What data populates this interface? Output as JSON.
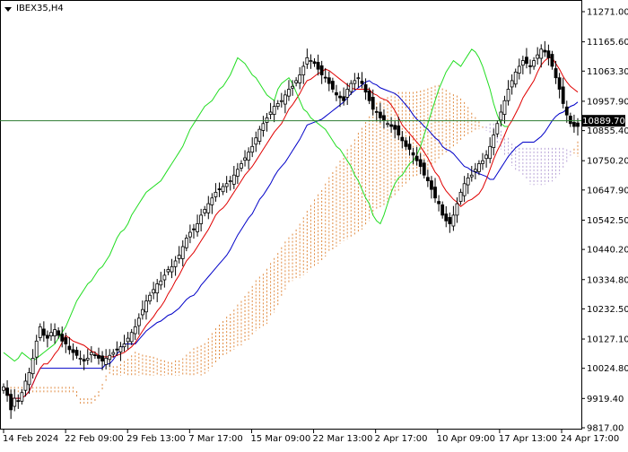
{
  "window": {
    "symbol_label": "IBEX35,H4"
  },
  "colors": {
    "background": "#ffffff",
    "candle": "#000000",
    "tenkan": "#e00000",
    "kijun": "#0000c8",
    "chikou": "#22dd22",
    "cloud_bull": "#e08a40",
    "cloud_bear": "#b7a2d6",
    "price_line": "#2e7d32"
  },
  "current_price": {
    "label": "10889.70",
    "value": 10889.7
  },
  "chart_data": {
    "type": "candlestick",
    "title": "IBEX35,H4",
    "xlabel": "",
    "ylabel": "",
    "ylim": [
      9817.0,
      11271.0
    ],
    "grid": false,
    "indicator": "Ichimoku Kinko Hyo",
    "y_ticks": [
      "11271.00",
      "11165.60",
      "11063.30",
      "10957.90",
      "10855.40",
      "10750.20",
      "10647.90",
      "10542.50",
      "10440.20",
      "10334.80",
      "10232.50",
      "10127.10",
      "10024.80",
      "9919.40",
      "9817.00"
    ],
    "x_ticks": [
      "14 Feb 2024",
      "22 Feb 09:00",
      "29 Feb 13:00",
      "7 Mar 17:00",
      "15 Mar 09:00",
      "22 Mar 13:00",
      "2 Apr 17:00",
      "10 Apr 09:00",
      "17 Apr 13:00",
      "24 Apr 17:00"
    ],
    "close_series": [
      9960,
      9930,
      9880,
      9920,
      9910,
      9940,
      9980,
      10010,
      10060,
      10120,
      10170,
      10140,
      10130,
      10150,
      10160,
      10140,
      10120,
      10110,
      10090,
      10080,
      10070,
      10060,
      10050,
      10060,
      10080,
      10070,
      10060,
      10050,
      10060,
      10070,
      10080,
      10090,
      10100,
      10110,
      10130,
      10150,
      10170,
      10200,
      10230,
      10260,
      10280,
      10300,
      10320,
      10330,
      10350,
      10370,
      10380,
      10400,
      10420,
      10450,
      10480,
      10500,
      10510,
      10530,
      10560,
      10580,
      10600,
      10620,
      10640,
      10650,
      10660,
      10670,
      10680,
      10700,
      10720,
      10740,
      10760,
      10780,
      10800,
      10830,
      10860,
      10880,
      10900,
      10920,
      10940,
      10950,
      10960,
      10980,
      11000,
      11010,
      11030,
      11050,
      11080,
      11110,
      11100,
      11090,
      11070,
      11050,
      11040,
      11020,
      11000,
      10980,
      10970,
      10960,
      11000,
      11020,
      11030,
      11040,
      11020,
      10990,
      10960,
      10930,
      10920,
      10900,
      10890,
      10880,
      10870,
      10860,
      10840,
      10820,
      10800,
      10790,
      10770,
      10750,
      10730,
      10700,
      10680,
      10650,
      10620,
      10600,
      10560,
      10540,
      10530,
      10560,
      10600,
      10640,
      10670,
      10690,
      10700,
      10720,
      10740,
      10750,
      10770,
      10800,
      10840,
      10880,
      10920,
      10960,
      11000,
      11030,
      11060,
      11080,
      11100,
      11090,
      11080,
      11100,
      11120,
      11140,
      11130,
      11110,
      11080,
      11040,
      11000,
      10950,
      10910,
      10880,
      10870,
      10870
    ]
  }
}
